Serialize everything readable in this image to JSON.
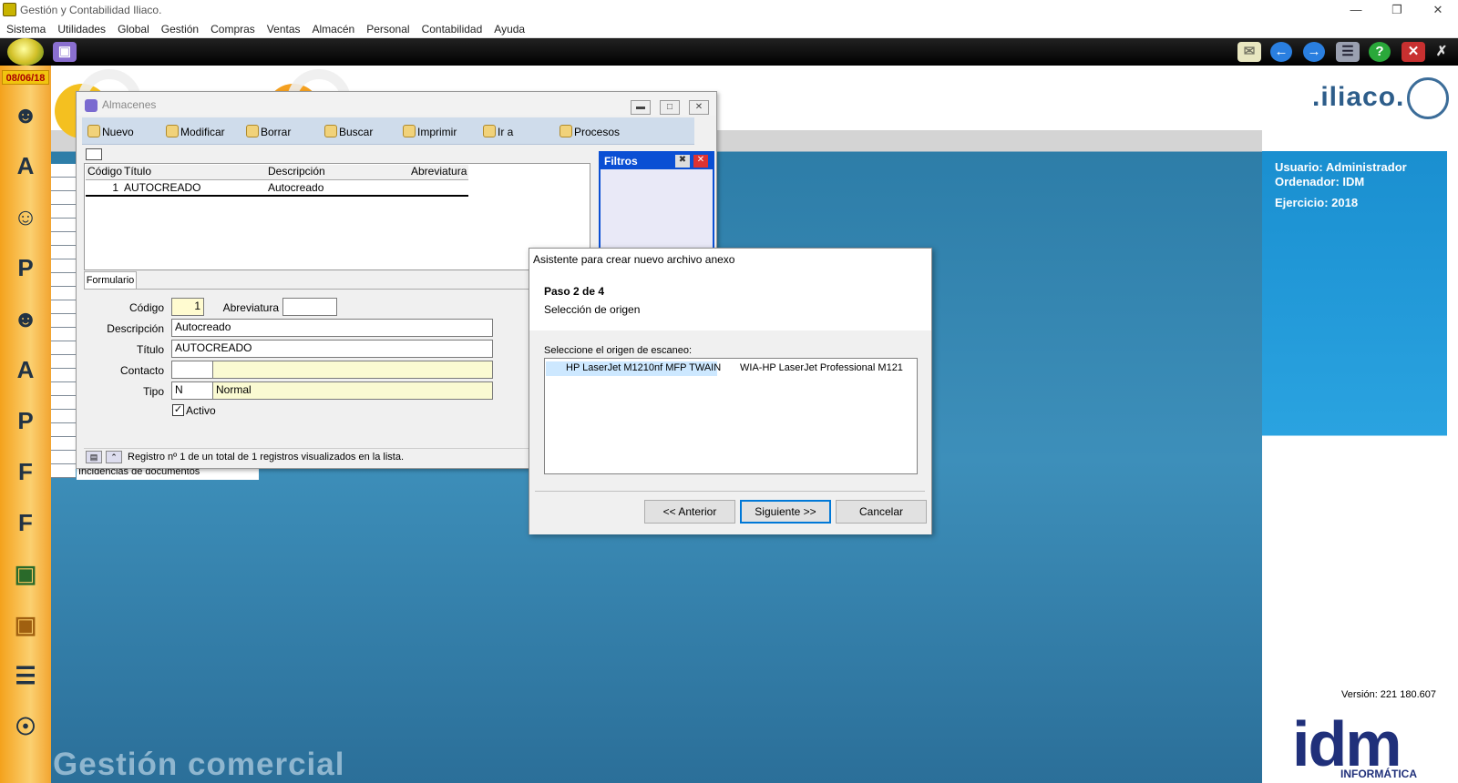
{
  "window": {
    "title": "Gestión y Contabilidad Iliaco."
  },
  "menu": [
    "Sistema",
    "Utilidades",
    "Global",
    "Gestión",
    "Compras",
    "Ventas",
    "Almacén",
    "Personal",
    "Contabilidad",
    "Ayuda"
  ],
  "sidebar": {
    "date": "08/06/18"
  },
  "brand": {
    "logo": ".iliaco.",
    "app_name": "Gestión comercial",
    "company": "idm",
    "company_sub": "INFORMÁTICA",
    "version": "Versión: 221 180.607"
  },
  "session": {
    "user": "Usuario: Administrador",
    "computer": "Ordenador: IDM",
    "year": "Ejercicio: 2018"
  },
  "almacenes": {
    "title": "Almacenes",
    "toolbar": [
      "Nuevo",
      "Modificar",
      "Borrar",
      "Buscar",
      "Imprimir",
      "Ir a",
      "Procesos"
    ],
    "grid": {
      "headers": [
        "Código",
        "Título",
        "Descripción",
        "Abreviatura"
      ],
      "rows": [
        [
          "1",
          "AUTOCREADO",
          "Autocreado",
          ""
        ]
      ]
    },
    "filtros": "Filtros",
    "form_tab": "Formulario",
    "form": {
      "codigo_label": "Código",
      "codigo": "1",
      "abrev_label": "Abreviatura",
      "abrev": "",
      "descripcion_label": "Descripción",
      "descripcion": "Autocreado",
      "titulo_label": "Título",
      "titulo": "AUTOCREADO",
      "contacto_label": "Contacto",
      "contacto": "",
      "contacto_name": "",
      "tipo_label": "Tipo",
      "tipo": "N",
      "tipo_name": "Normal",
      "activo_label": "Activo",
      "activo": true
    },
    "status": "Registro nº 1 de un total de 1 registros visualizados en la lista."
  },
  "incidencias": "Incidencias de documentos",
  "wizard": {
    "title": "Asistente para crear nuevo archivo anexo",
    "step": "Paso 2 de 4",
    "subtitle": "Selección de origen",
    "prompt": "Seleccione el origen de escaneo:",
    "sources": [
      "HP LaserJet M1210nf MFP TWAIN",
      "WIA-HP LaserJet Professional M121"
    ],
    "selected_source": "HP LaserJet M1210nf MFP TWAIN",
    "buttons": {
      "back": "<< Anterior",
      "next": "Siguiente >>",
      "cancel": "Cancelar"
    }
  },
  "colors": {
    "filter_header": "#0a4fd4",
    "info_panel": "#1a8fd0",
    "desktop": "#2d7da8",
    "sidebar": "#f4a21c"
  }
}
